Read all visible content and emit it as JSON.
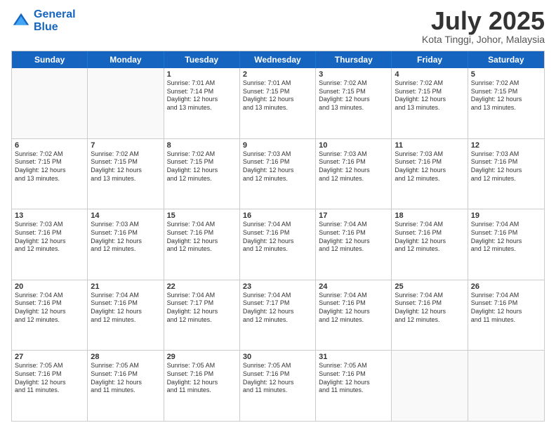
{
  "header": {
    "logo_line1": "General",
    "logo_line2": "Blue",
    "month": "July 2025",
    "location": "Kota Tinggi, Johor, Malaysia"
  },
  "days_of_week": [
    "Sunday",
    "Monday",
    "Tuesday",
    "Wednesday",
    "Thursday",
    "Friday",
    "Saturday"
  ],
  "weeks": [
    [
      {
        "day": "",
        "info": ""
      },
      {
        "day": "",
        "info": ""
      },
      {
        "day": "1",
        "info": "Sunrise: 7:01 AM\nSunset: 7:14 PM\nDaylight: 12 hours\nand 13 minutes."
      },
      {
        "day": "2",
        "info": "Sunrise: 7:01 AM\nSunset: 7:15 PM\nDaylight: 12 hours\nand 13 minutes."
      },
      {
        "day": "3",
        "info": "Sunrise: 7:02 AM\nSunset: 7:15 PM\nDaylight: 12 hours\nand 13 minutes."
      },
      {
        "day": "4",
        "info": "Sunrise: 7:02 AM\nSunset: 7:15 PM\nDaylight: 12 hours\nand 13 minutes."
      },
      {
        "day": "5",
        "info": "Sunrise: 7:02 AM\nSunset: 7:15 PM\nDaylight: 12 hours\nand 13 minutes."
      }
    ],
    [
      {
        "day": "6",
        "info": "Sunrise: 7:02 AM\nSunset: 7:15 PM\nDaylight: 12 hours\nand 13 minutes."
      },
      {
        "day": "7",
        "info": "Sunrise: 7:02 AM\nSunset: 7:15 PM\nDaylight: 12 hours\nand 13 minutes."
      },
      {
        "day": "8",
        "info": "Sunrise: 7:02 AM\nSunset: 7:15 PM\nDaylight: 12 hours\nand 12 minutes."
      },
      {
        "day": "9",
        "info": "Sunrise: 7:03 AM\nSunset: 7:16 PM\nDaylight: 12 hours\nand 12 minutes."
      },
      {
        "day": "10",
        "info": "Sunrise: 7:03 AM\nSunset: 7:16 PM\nDaylight: 12 hours\nand 12 minutes."
      },
      {
        "day": "11",
        "info": "Sunrise: 7:03 AM\nSunset: 7:16 PM\nDaylight: 12 hours\nand 12 minutes."
      },
      {
        "day": "12",
        "info": "Sunrise: 7:03 AM\nSunset: 7:16 PM\nDaylight: 12 hours\nand 12 minutes."
      }
    ],
    [
      {
        "day": "13",
        "info": "Sunrise: 7:03 AM\nSunset: 7:16 PM\nDaylight: 12 hours\nand 12 minutes."
      },
      {
        "day": "14",
        "info": "Sunrise: 7:03 AM\nSunset: 7:16 PM\nDaylight: 12 hours\nand 12 minutes."
      },
      {
        "day": "15",
        "info": "Sunrise: 7:04 AM\nSunset: 7:16 PM\nDaylight: 12 hours\nand 12 minutes."
      },
      {
        "day": "16",
        "info": "Sunrise: 7:04 AM\nSunset: 7:16 PM\nDaylight: 12 hours\nand 12 minutes."
      },
      {
        "day": "17",
        "info": "Sunrise: 7:04 AM\nSunset: 7:16 PM\nDaylight: 12 hours\nand 12 minutes."
      },
      {
        "day": "18",
        "info": "Sunrise: 7:04 AM\nSunset: 7:16 PM\nDaylight: 12 hours\nand 12 minutes."
      },
      {
        "day": "19",
        "info": "Sunrise: 7:04 AM\nSunset: 7:16 PM\nDaylight: 12 hours\nand 12 minutes."
      }
    ],
    [
      {
        "day": "20",
        "info": "Sunrise: 7:04 AM\nSunset: 7:16 PM\nDaylight: 12 hours\nand 12 minutes."
      },
      {
        "day": "21",
        "info": "Sunrise: 7:04 AM\nSunset: 7:16 PM\nDaylight: 12 hours\nand 12 minutes."
      },
      {
        "day": "22",
        "info": "Sunrise: 7:04 AM\nSunset: 7:17 PM\nDaylight: 12 hours\nand 12 minutes."
      },
      {
        "day": "23",
        "info": "Sunrise: 7:04 AM\nSunset: 7:17 PM\nDaylight: 12 hours\nand 12 minutes."
      },
      {
        "day": "24",
        "info": "Sunrise: 7:04 AM\nSunset: 7:16 PM\nDaylight: 12 hours\nand 12 minutes."
      },
      {
        "day": "25",
        "info": "Sunrise: 7:04 AM\nSunset: 7:16 PM\nDaylight: 12 hours\nand 12 minutes."
      },
      {
        "day": "26",
        "info": "Sunrise: 7:04 AM\nSunset: 7:16 PM\nDaylight: 12 hours\nand 11 minutes."
      }
    ],
    [
      {
        "day": "27",
        "info": "Sunrise: 7:05 AM\nSunset: 7:16 PM\nDaylight: 12 hours\nand 11 minutes."
      },
      {
        "day": "28",
        "info": "Sunrise: 7:05 AM\nSunset: 7:16 PM\nDaylight: 12 hours\nand 11 minutes."
      },
      {
        "day": "29",
        "info": "Sunrise: 7:05 AM\nSunset: 7:16 PM\nDaylight: 12 hours\nand 11 minutes."
      },
      {
        "day": "30",
        "info": "Sunrise: 7:05 AM\nSunset: 7:16 PM\nDaylight: 12 hours\nand 11 minutes."
      },
      {
        "day": "31",
        "info": "Sunrise: 7:05 AM\nSunset: 7:16 PM\nDaylight: 12 hours\nand 11 minutes."
      },
      {
        "day": "",
        "info": ""
      },
      {
        "day": "",
        "info": ""
      }
    ]
  ]
}
